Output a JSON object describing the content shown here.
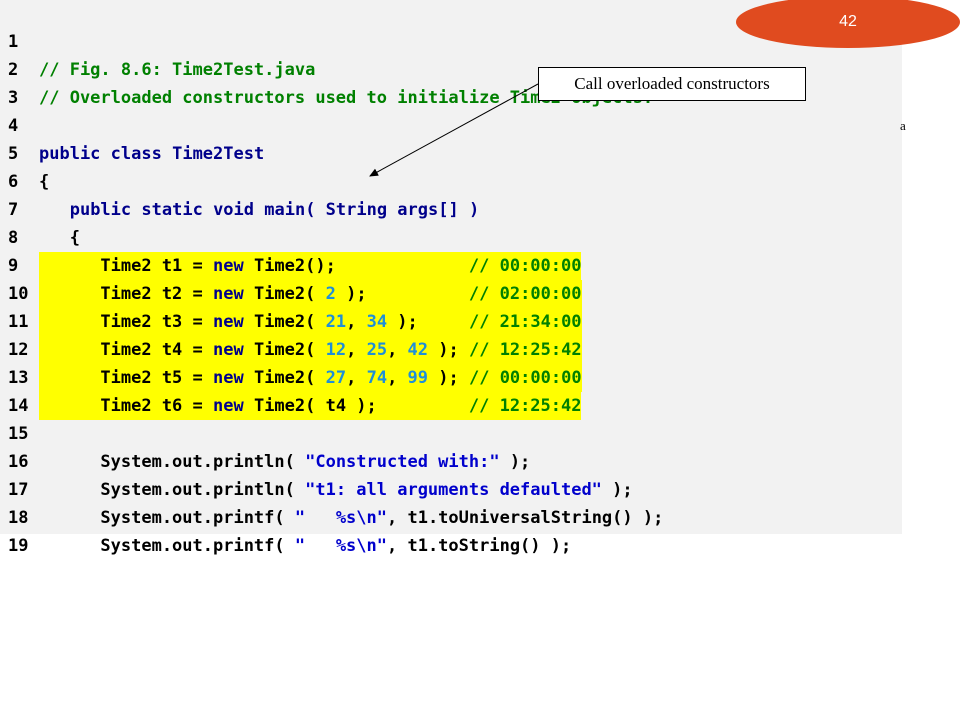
{
  "slide": {
    "page_number": "42",
    "callout_text": "Call overloaded constructors",
    "stray_text": "a"
  },
  "code": {
    "lines": [
      {
        "n": "1",
        "t": "// Fig. 8.6: Time2Test.java"
      },
      {
        "n": "2",
        "t": "// Overloaded constructors used to initialize Time2 objects."
      },
      {
        "n": "3",
        "t": ""
      },
      {
        "n": "4",
        "t": "public class Time2Test"
      },
      {
        "n": "5",
        "t": "{"
      },
      {
        "n": "6",
        "t": "   public static void main( String args[] )"
      },
      {
        "n": "7",
        "t": "   {"
      },
      {
        "n": "8",
        "t": "      Time2 t1 = new Time2();             // 00:00:00"
      },
      {
        "n": "9",
        "t": "      Time2 t2 = new Time2( 2 );          // 02:00:00"
      },
      {
        "n": "10",
        "t": "      Time2 t3 = new Time2( 21, 34 );     // 21:34:00"
      },
      {
        "n": "11",
        "t": "      Time2 t4 = new Time2( 12, 25, 42 ); // 12:25:42"
      },
      {
        "n": "12",
        "t": "      Time2 t5 = new Time2( 27, 74, 99 ); // 00:00:00"
      },
      {
        "n": "13",
        "t": "      Time2 t6 = new Time2( t4 );         // 12:25:42"
      },
      {
        "n": "14",
        "t": ""
      },
      {
        "n": "15",
        "t": "      System.out.println( \"Constructed with:\" );"
      },
      {
        "n": "16",
        "t": "      System.out.println( \"t1: all arguments defaulted\" );"
      },
      {
        "n": "17",
        "t": "      System.out.printf( \"   %s\\n\", t1.toUniversalString() );"
      },
      {
        "n": "18",
        "t": "      System.out.printf( \"   %s\\n\", t1.toString() );"
      },
      {
        "n": "19",
        "t": ""
      }
    ]
  },
  "colors": {
    "badge": "#e04b1f",
    "highlight": "#ffff00",
    "comment": "#008000",
    "keyword": "#00008b",
    "string": "#0000cc",
    "number": "#1f8fd8"
  }
}
